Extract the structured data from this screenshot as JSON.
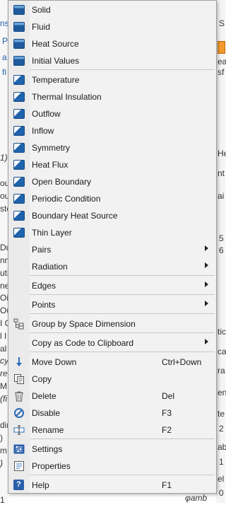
{
  "background": {
    "left_fragments": [
      "ns",
      "P",
      "a",
      "fi",
      "1)",
      "ou",
      "ou",
      "ste",
      "Du",
      "nn",
      "uti",
      "ne",
      "Oi",
      "Ou",
      "I C",
      "l I",
      "al",
      "cy",
      "re",
      "M",
      "(fi",
      "din",
      ")",
      "m",
      ")",
      "1"
    ],
    "right_fragments": [
      "S",
      "ea",
      "sf",
      "He",
      "nt",
      "ai",
      "5",
      "6",
      "tic",
      "ca",
      "ra",
      "en",
      "te",
      "2",
      "ab",
      "1",
      "el",
      "0"
    ],
    "bottom_right_label": "φamb"
  },
  "menu": {
    "physics_items": [
      {
        "label": "Solid",
        "icon": "physics-icon"
      },
      {
        "label": "Fluid",
        "icon": "physics-icon"
      },
      {
        "label": "Heat Source",
        "icon": "physics-icon"
      },
      {
        "label": "Initial Values",
        "icon": "physics-icon"
      }
    ],
    "boundary_items": [
      {
        "label": "Temperature",
        "icon": "boundary-condition-icon"
      },
      {
        "label": "Thermal Insulation",
        "icon": "boundary-condition-icon"
      },
      {
        "label": "Outflow",
        "icon": "boundary-condition-icon"
      },
      {
        "label": "Inflow",
        "icon": "boundary-condition-icon"
      },
      {
        "label": "Symmetry",
        "icon": "boundary-condition-icon"
      },
      {
        "label": "Heat Flux",
        "icon": "boundary-condition-icon"
      },
      {
        "label": "Open Boundary",
        "icon": "boundary-condition-icon"
      },
      {
        "label": "Periodic Condition",
        "icon": "boundary-condition-icon"
      },
      {
        "label": "Boundary Heat Source",
        "icon": "boundary-condition-icon"
      },
      {
        "label": "Thin Layer",
        "icon": "boundary-condition-icon"
      }
    ],
    "submenus_a": [
      {
        "label": "Pairs"
      },
      {
        "label": "Radiation"
      }
    ],
    "edges": "Edges",
    "points": "Points",
    "group_by_space_dimension": "Group by Space Dimension",
    "copy_as_code": "Copy as Code to Clipboard",
    "actions": [
      {
        "label": "Move Down",
        "shortcut": "Ctrl+Down",
        "icon": "move-down-icon"
      },
      {
        "label": "Copy",
        "shortcut": "",
        "icon": "copy-icon"
      },
      {
        "label": "Delete",
        "shortcut": "Del",
        "icon": "delete-icon"
      },
      {
        "label": "Disable",
        "shortcut": "F3",
        "icon": "disable-icon"
      },
      {
        "label": "Rename",
        "shortcut": "F2",
        "icon": "rename-icon"
      }
    ],
    "settings": "Settings",
    "properties": "Properties",
    "help": {
      "label": "Help",
      "shortcut": "F1",
      "glyph": "?"
    }
  }
}
